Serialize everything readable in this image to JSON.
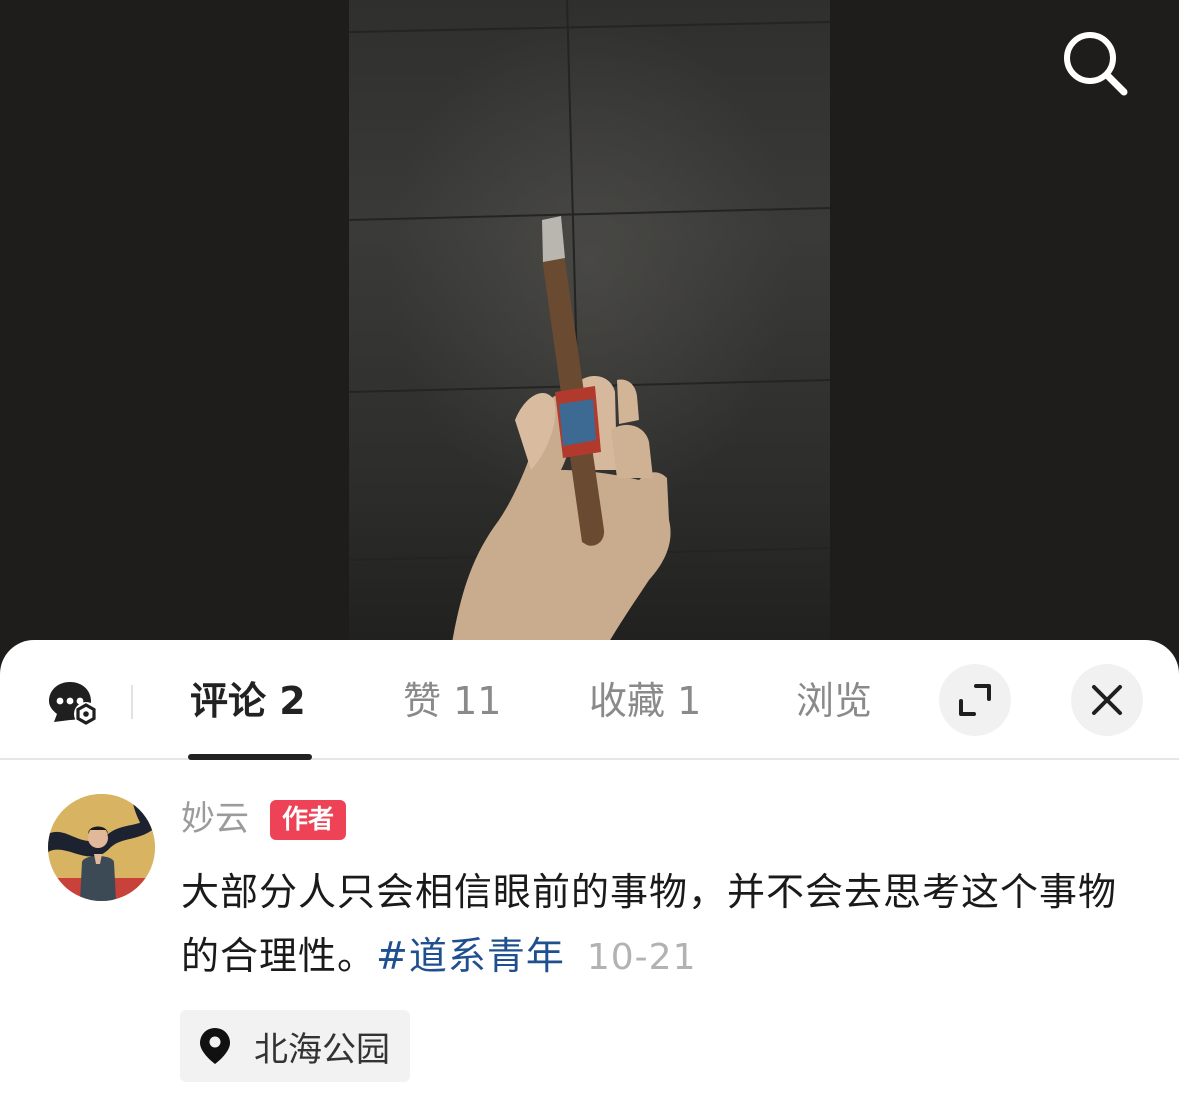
{
  "photo": {
    "subject": "cigar-in-hand"
  },
  "header": {
    "search_icon": "search-icon"
  },
  "tabs": [
    {
      "label": "评论 2",
      "active": true
    },
    {
      "label": "赞 11",
      "active": false
    },
    {
      "label": "收藏 1",
      "active": false
    },
    {
      "label": "浏览",
      "active": false
    }
  ],
  "icons": {
    "chat": "chat-settings-icon",
    "expand": "expand-icon",
    "close": "close-icon"
  },
  "comment": {
    "author": "妙云",
    "badge": "作者",
    "text": "大部分人只会相信眼前的事物，并不会去思考这个事物的合理性。",
    "hashtag": "#道系青年",
    "date": "10-21",
    "location": "北海公园"
  },
  "colors": {
    "badge": "#ee4256",
    "hashtag": "#1f4f8f",
    "accent_text": "#222222"
  }
}
